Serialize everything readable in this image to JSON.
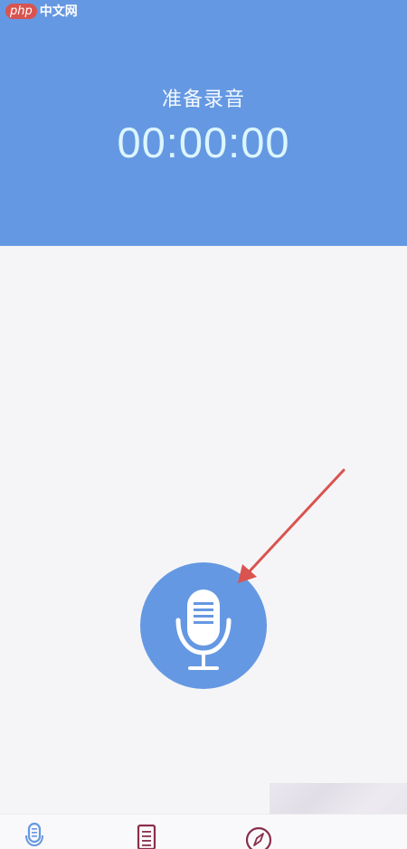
{
  "watermark": {
    "php": "php",
    "site": "中文网"
  },
  "header": {
    "status_label": "准备录音",
    "timer": "00:00:00"
  },
  "record_button": {
    "icon": "microphone-icon"
  },
  "annotation": {
    "type": "arrow",
    "color": "#d9534f"
  },
  "tabbar": {
    "tabs": [
      {
        "icon": "microphone-icon",
        "active": true
      },
      {
        "icon": "document-list-icon",
        "active": false
      },
      {
        "icon": "compass-icon",
        "active": false
      }
    ]
  },
  "colors": {
    "primary": "#6598e2",
    "background": "#f5f5f7",
    "timer_text": "#dcf6ff",
    "tab_icon": "#8a2f4a"
  }
}
